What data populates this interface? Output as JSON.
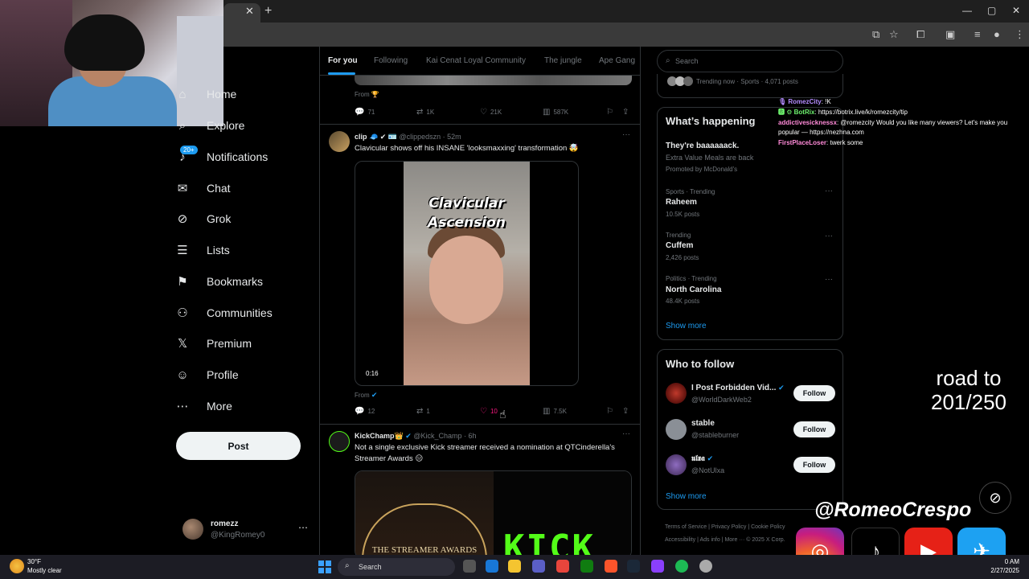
{
  "browser": {
    "tab_close": "✕",
    "new_tab": "+",
    "min": "—",
    "max": "▢",
    "close": "✕"
  },
  "sidebar": {
    "items": [
      {
        "label": "Home",
        "icon": "home-icon",
        "glyph": "⌂"
      },
      {
        "label": "Explore",
        "icon": "search-icon",
        "glyph": "⌕"
      },
      {
        "label": "Notifications",
        "icon": "bell-icon",
        "glyph": "♫",
        "badge": "20+"
      },
      {
        "label": "Chat",
        "icon": "mail-icon",
        "glyph": "✉"
      },
      {
        "label": "Grok",
        "icon": "grok-icon",
        "glyph": "⊘"
      },
      {
        "label": "Lists",
        "icon": "list-icon",
        "glyph": "☰"
      },
      {
        "label": "Bookmarks",
        "icon": "bookmark-icon",
        "glyph": "⚑"
      },
      {
        "label": "Communities",
        "icon": "people-icon",
        "glyph": "⚇"
      },
      {
        "label": "Premium",
        "icon": "x-logo-icon",
        "glyph": "𝕏"
      },
      {
        "label": "Profile",
        "icon": "person-icon",
        "glyph": "☺"
      },
      {
        "label": "More",
        "icon": "more-circle-icon",
        "glyph": "⋯"
      }
    ],
    "post_button": "Post",
    "account": {
      "name": "romezz",
      "handle": "@KingRomey0",
      "more": "⋯"
    }
  },
  "feed": {
    "tabs": [
      "For you",
      "Following",
      "Kai Cenat Loyal Community",
      "The jungle",
      "Ape Gang"
    ],
    "prev_post": {
      "from": "From 🏆",
      "replies": "71",
      "reposts": "1K",
      "likes": "21K",
      "views": "587K"
    },
    "post1": {
      "name": "clip",
      "badges": "🧢 ✔ 🪪",
      "meta": "@clippedszn · 52m",
      "text": "Clavicular shows off his INSANE 'looksmaxxing' transformation 🤯",
      "video_title_1": "Clavicular",
      "video_title_2": "Ascension",
      "duration": "0:16",
      "from": "From",
      "replies": "12",
      "reposts": "1",
      "likes": "10",
      "views": "7.5K"
    },
    "post2": {
      "name": "KickChamp👑",
      "meta": "@Kick_Champ · 6h",
      "text": "Not a single exclusive Kick streamer received a nomination at QTCinderella's Streamer Awards 😑",
      "image_caption": "THE STREAMER AWARDS",
      "image_logo": "KICK"
    }
  },
  "right": {
    "search_placeholder": "Search",
    "trending_now": "Trending now · Sports · 4,071 posts",
    "happening_title": "What’s happening",
    "promo": {
      "title": "They're baaaaaack.",
      "subtitle": "Extra Value Meals are back",
      "promoted": "Promoted by McDonald's"
    },
    "trends": [
      {
        "context": "Sports · Trending",
        "name": "Raheem",
        "count": "10.5K posts"
      },
      {
        "context": "Trending",
        "name": "Cuffem",
        "count": "2,426 posts"
      },
      {
        "context": "Politics · Trending",
        "name": "North Carolina",
        "count": "48.4K posts"
      }
    ],
    "show_more": "Show more",
    "wtf_title": "Who to follow",
    "follows": [
      {
        "name": "I Post Forbidden Vid...",
        "handle": "@WorldDarkWeb2",
        "verified": "✔"
      },
      {
        "name": "stable",
        "handle": "@stableburner",
        "verified": ""
      },
      {
        "name": "𝖚𝖑𝖝𝖆",
        "handle": "@NotUlxa",
        "verified": "✔"
      }
    ],
    "follow_label": "Follow",
    "footer_line1": "Terms of Service   |   Privacy Policy   |   Cookie Policy",
    "footer_line2": "Accessibility   |   Ads info   |   More ···   © 2025 X Corp."
  },
  "chat": [
    {
      "user": "🎙 RomezCity",
      "msg": ": !K",
      "color": "#b48cff"
    },
    {
      "user": "🅱 ⚙ BotRix",
      "msg": ": https://botrix.live/k/romezcity/tip",
      "color": "#6ef26e"
    },
    {
      "user": "addictivesicknessx",
      "msg": ": @romezcity Would you like many viewers? Let's make you popular — https://nezhna.com",
      "color": "#ff8ad8"
    },
    {
      "user": "FirstPlaceLoser",
      "msg": ": twerk some",
      "color": "#ff8ad8"
    }
  ],
  "overlay": {
    "road_line1": "road to",
    "road_line2": "201/250",
    "handle": "@RomeoCrespo",
    "grok": "⊘"
  },
  "taskbar": {
    "temp": "30°F",
    "condition": "Mostly clear",
    "search": "Search",
    "time": "0 AM",
    "date": "2/27/2025"
  }
}
